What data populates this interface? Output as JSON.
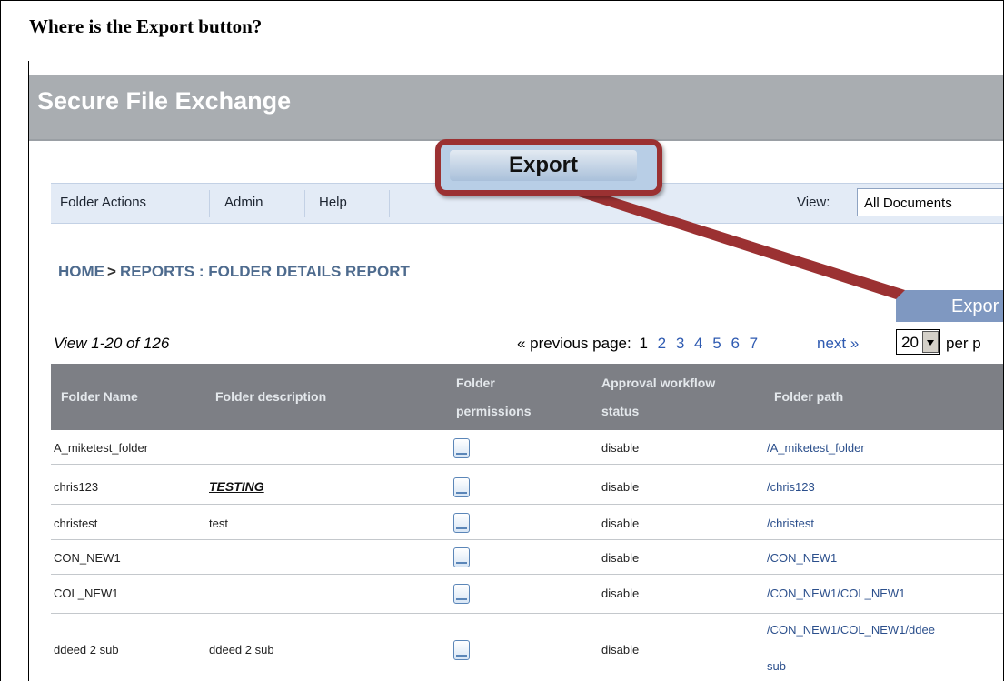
{
  "question": "Where is the Export button?",
  "app": {
    "title": "Secure File Exchange"
  },
  "callout": {
    "label": "Export"
  },
  "nav": {
    "items": [
      "Folder Actions",
      "Admin",
      "Help"
    ],
    "view_label": "View:",
    "view_value": "All Documents"
  },
  "breadcrumb": {
    "home": "HOME",
    "separator": ">",
    "current": "REPORTS : FOLDER DETAILS REPORT"
  },
  "export_button": {
    "label": "Expor"
  },
  "pagination": {
    "view_count": "View 1-20 of 126",
    "prev_text": "« previous page:",
    "current_page": "1",
    "pages": [
      "2",
      "3",
      "4",
      "5",
      "6",
      "7"
    ],
    "next_text": "next »",
    "per_page_value": "20",
    "per_page_label": "per p"
  },
  "table": {
    "headers": {
      "name": "Folder Name",
      "description": "Folder description",
      "permissions_1": "Folder",
      "permissions_2": "permissions",
      "status_1": "Approval workflow",
      "status_2": "status",
      "path": "Folder path"
    },
    "rows": [
      {
        "name": "A_miketest_folder",
        "description": "",
        "status": "disable",
        "path": "/A_miketest_folder"
      },
      {
        "name": "chris123",
        "description": "TESTING",
        "status": "disable",
        "path": "/chris123"
      },
      {
        "name": "christest",
        "description": "test",
        "status": "disable",
        "path": "/christest"
      },
      {
        "name": "CON_NEW1",
        "description": "",
        "status": "disable",
        "path": "/CON_NEW1"
      },
      {
        "name": "COL_NEW1",
        "description": "",
        "status": "disable",
        "path": "/CON_NEW1/COL_NEW1"
      },
      {
        "name": "ddeed 2 sub",
        "description": "ddeed 2 sub",
        "status": "disable",
        "path": "/CON_NEW1/COL_NEW1/ddee",
        "path_line2": "sub"
      }
    ]
  },
  "colors": {
    "callout_border": "#9b3132",
    "header_bg": "#7d7f85",
    "nav_bg": "#e3ebf6",
    "link": "#2e5ab1",
    "appbar": "#a9adb1"
  }
}
